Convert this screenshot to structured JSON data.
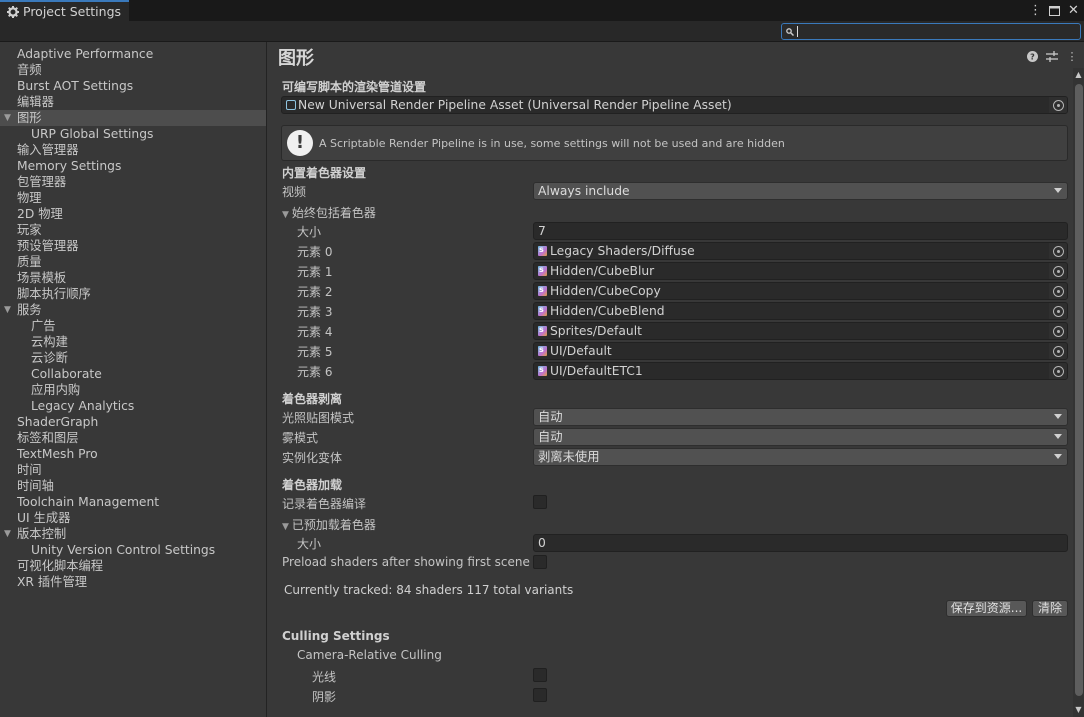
{
  "window": {
    "tab_title": "Project Settings",
    "tab_icon": "gear-icon",
    "controls": [
      "more-icon",
      "maximize-icon",
      "close-icon"
    ]
  },
  "search": {
    "value": "",
    "placeholder": ""
  },
  "sidebar": {
    "items": [
      {
        "label": "Adaptive Performance",
        "level": 0
      },
      {
        "label": "音频",
        "level": 0
      },
      {
        "label": "Burst AOT Settings",
        "level": 0
      },
      {
        "label": "编辑器",
        "level": 0
      },
      {
        "label": "图形",
        "level": 0,
        "expanded": true,
        "selected": true
      },
      {
        "label": "URP Global Settings",
        "level": 1
      },
      {
        "label": "输入管理器",
        "level": 0
      },
      {
        "label": "Memory Settings",
        "level": 0
      },
      {
        "label": "包管理器",
        "level": 0
      },
      {
        "label": "物理",
        "level": 0
      },
      {
        "label": "2D 物理",
        "level": 0
      },
      {
        "label": "玩家",
        "level": 0
      },
      {
        "label": "预设管理器",
        "level": 0
      },
      {
        "label": "质量",
        "level": 0
      },
      {
        "label": "场景模板",
        "level": 0
      },
      {
        "label": "脚本执行顺序",
        "level": 0
      },
      {
        "label": "服务",
        "level": 0,
        "expanded": true
      },
      {
        "label": "广告",
        "level": 1
      },
      {
        "label": "云构建",
        "level": 1
      },
      {
        "label": "云诊断",
        "level": 1
      },
      {
        "label": "Collaborate",
        "level": 1
      },
      {
        "label": "应用内购",
        "level": 1
      },
      {
        "label": "Legacy Analytics",
        "level": 1
      },
      {
        "label": "ShaderGraph",
        "level": 0
      },
      {
        "label": "标签和图层",
        "level": 0
      },
      {
        "label": "TextMesh Pro",
        "level": 0
      },
      {
        "label": "时间",
        "level": 0
      },
      {
        "label": "时间轴",
        "level": 0
      },
      {
        "label": "Toolchain Management",
        "level": 0
      },
      {
        "label": "UI 生成器",
        "level": 0
      },
      {
        "label": "版本控制",
        "level": 0,
        "expanded": true
      },
      {
        "label": "Unity Version Control Settings",
        "level": 1
      },
      {
        "label": "可视化脚本编程",
        "level": 0
      },
      {
        "label": "XR 插件管理",
        "level": 0
      }
    ]
  },
  "main": {
    "title": "图形",
    "header_icons": [
      "help-icon",
      "preset-icon",
      "more-icon"
    ],
    "srp_section": "可编写脚本的渲染管道设置",
    "srp_asset": "New Universal Render Pipeline Asset (Universal Render Pipeline Asset)",
    "help_message": "A Scriptable Render Pipeline is in use, some settings will not be used and are hidden",
    "builtin_section": "内置着色器设置",
    "video_label": "视频",
    "video_value": "Always include",
    "always_included_label": "始终包括着色器",
    "size_label": "大小",
    "size_value": "7",
    "elements": [
      {
        "label": "元素 0",
        "value": "Legacy Shaders/Diffuse"
      },
      {
        "label": "元素 1",
        "value": "Hidden/CubeBlur"
      },
      {
        "label": "元素 2",
        "value": "Hidden/CubeCopy"
      },
      {
        "label": "元素 3",
        "value": "Hidden/CubeBlend"
      },
      {
        "label": "元素 4",
        "value": "Sprites/Default"
      },
      {
        "label": "元素 5",
        "value": "UI/Default"
      },
      {
        "label": "元素 6",
        "value": "UI/DefaultETC1"
      }
    ],
    "stripping_section": "着色器剥离",
    "lightmap_label": "光照贴图模式",
    "lightmap_value": "自动",
    "fog_label": "雾模式",
    "fog_value": "自动",
    "instancing_label": "实例化变体",
    "instancing_value": "剥离未使用",
    "loading_section": "着色器加载",
    "log_compile_label": "记录着色器编译",
    "log_compile_checked": false,
    "preloaded_label": "已预加载着色器",
    "preloaded_size_label": "大小",
    "preloaded_size_value": "0",
    "preload_after_label": "Preload shaders after showing first scene",
    "preload_after_checked": false,
    "tracked_text": "Currently tracked: 84 shaders 117 total variants",
    "save_button": "保存到资源...",
    "clear_button": "清除",
    "culling_section": "Culling Settings",
    "camera_relative_label": "Camera-Relative Culling",
    "lights_label": "光线",
    "lights_checked": false,
    "shadows_label": "阴影",
    "shadows_checked": false
  }
}
